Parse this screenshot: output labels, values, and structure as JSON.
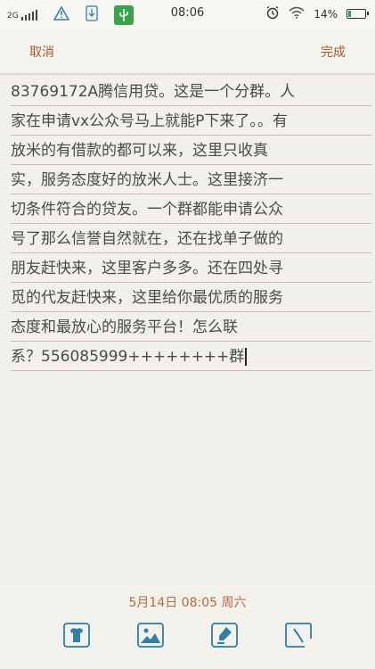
{
  "status_bar": {
    "network": "2G",
    "time": "08:06",
    "battery_percent": "14%",
    "battery_level": 0.14,
    "icons": [
      "signal-icon",
      "warning-icon",
      "download-icon",
      "usb-icon",
      "alarm-icon",
      "wifi-icon",
      "battery-icon"
    ]
  },
  "header": {
    "cancel_label": "取消",
    "done_label": "完成"
  },
  "note": {
    "lines": [
      "83769172A腾信用贷。这是一个分群。人",
      "家在申请vx公众号马上就能P下来了。。有",
      "放米的有借款的都可以来，这里只收真",
      "实，服务态度好的放米人士。这里接济一",
      "切条件符合的贷友。一个群都能申请公众",
      "号了那么信誉自然就在，还在找单子做的",
      "朋友赶快来，这里客户多多。还在四处寻",
      "觅的代友赶快来，这里给你最优质的服务",
      "态度和最放心的服务平台！怎么联",
      "系？556085999++++++++群"
    ]
  },
  "footer": {
    "date": "5月14日 08:05 周六"
  },
  "toolbar": {
    "tools": [
      "theme-icon",
      "image-icon",
      "marker-icon",
      "clock-icon"
    ]
  },
  "colors": {
    "accent": "#a65a2e",
    "line": "#d6b9ad",
    "icon_blue": "#2f7fa8"
  }
}
